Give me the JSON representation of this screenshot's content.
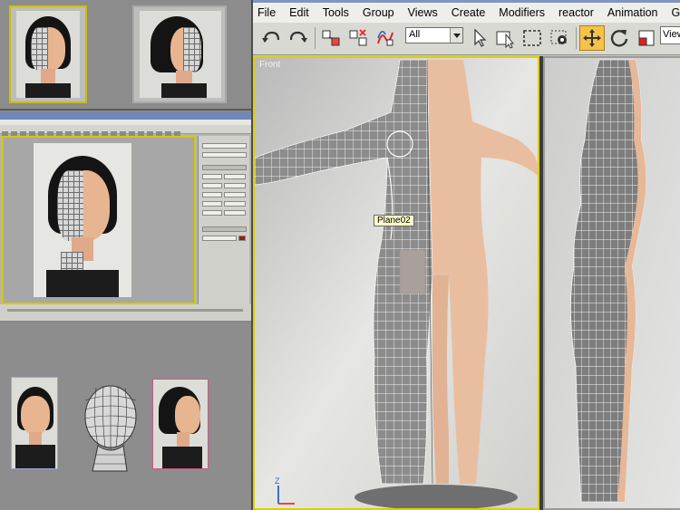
{
  "menubar": {
    "items": [
      "File",
      "Edit",
      "Tools",
      "Group",
      "Views",
      "Create",
      "Modifiers",
      "reactor",
      "Animation",
      "Graph Editor"
    ]
  },
  "toolbar": {
    "selection_filter": "All",
    "view_field": "View",
    "active_tool": "select-and-move"
  },
  "viewports": {
    "front": {
      "label": "Front",
      "tooltip": "Plane02"
    },
    "gizmo_axis": "Z"
  },
  "colors": {
    "active_viewport_border": "#dbd000",
    "menubar_bg": "#eeeeea",
    "toolbar_bg": "#d9d9d4",
    "active_button": "#f5c24a",
    "title_blue": "#7f95c0"
  },
  "icons": [
    "undo-icon",
    "redo-icon",
    "select-and-link-icon",
    "unlink-icon",
    "bind-space-warp-icon",
    "select-object-icon",
    "select-by-name-icon",
    "rectangular-selection-icon",
    "window-crossing-icon",
    "select-and-move-icon",
    "select-and-rotate-icon",
    "select-and-scale-icon"
  ]
}
